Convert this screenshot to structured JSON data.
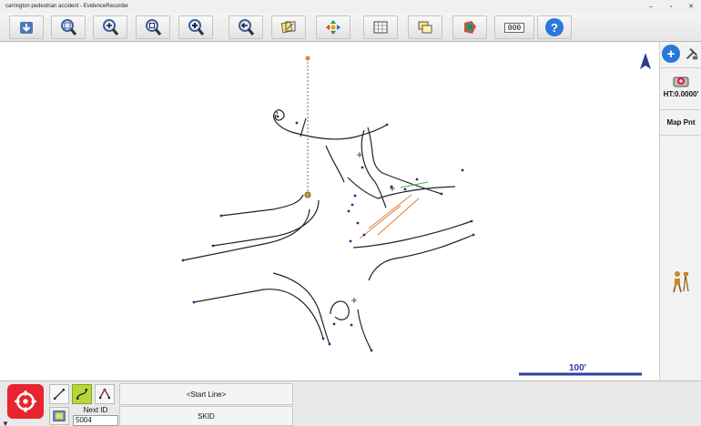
{
  "window": {
    "title": "carrington pedestrian accident - EvidenceRecorder",
    "minimize": "–",
    "maximize": "▫",
    "close": "✕"
  },
  "toolbar": {
    "buttons": [
      {
        "name": "import-icon"
      },
      {
        "name": "zoom-extents-icon"
      },
      {
        "name": "zoom-in-out-icon"
      },
      {
        "name": "zoom-window-icon"
      },
      {
        "name": "pan-zoom-icon"
      },
      {
        "name": "zoom-previous-icon"
      },
      {
        "name": "layers-icon"
      },
      {
        "name": "move-arrows-icon"
      },
      {
        "name": "grid-icon"
      },
      {
        "name": "windows-icon"
      },
      {
        "name": "palette-icon"
      },
      {
        "name": "counter-icon",
        "text": "000"
      },
      {
        "name": "help-icon",
        "text": "?"
      }
    ]
  },
  "map": {
    "north_label": "",
    "scale_label": "100'",
    "colors": {
      "road": "#222222",
      "point": "#2a2a8c",
      "skid": "#e07b39",
      "marker": "#c8a23a",
      "green": "#4caf50"
    }
  },
  "right_panel": {
    "height_label": "HT:0.0000'",
    "map_point_label": "Map Pnt"
  },
  "bottom_bar": {
    "start_line_label": "<Start Line>",
    "code_label": "SKID",
    "next_id_label": "Next ID",
    "next_id_value": "5004"
  }
}
